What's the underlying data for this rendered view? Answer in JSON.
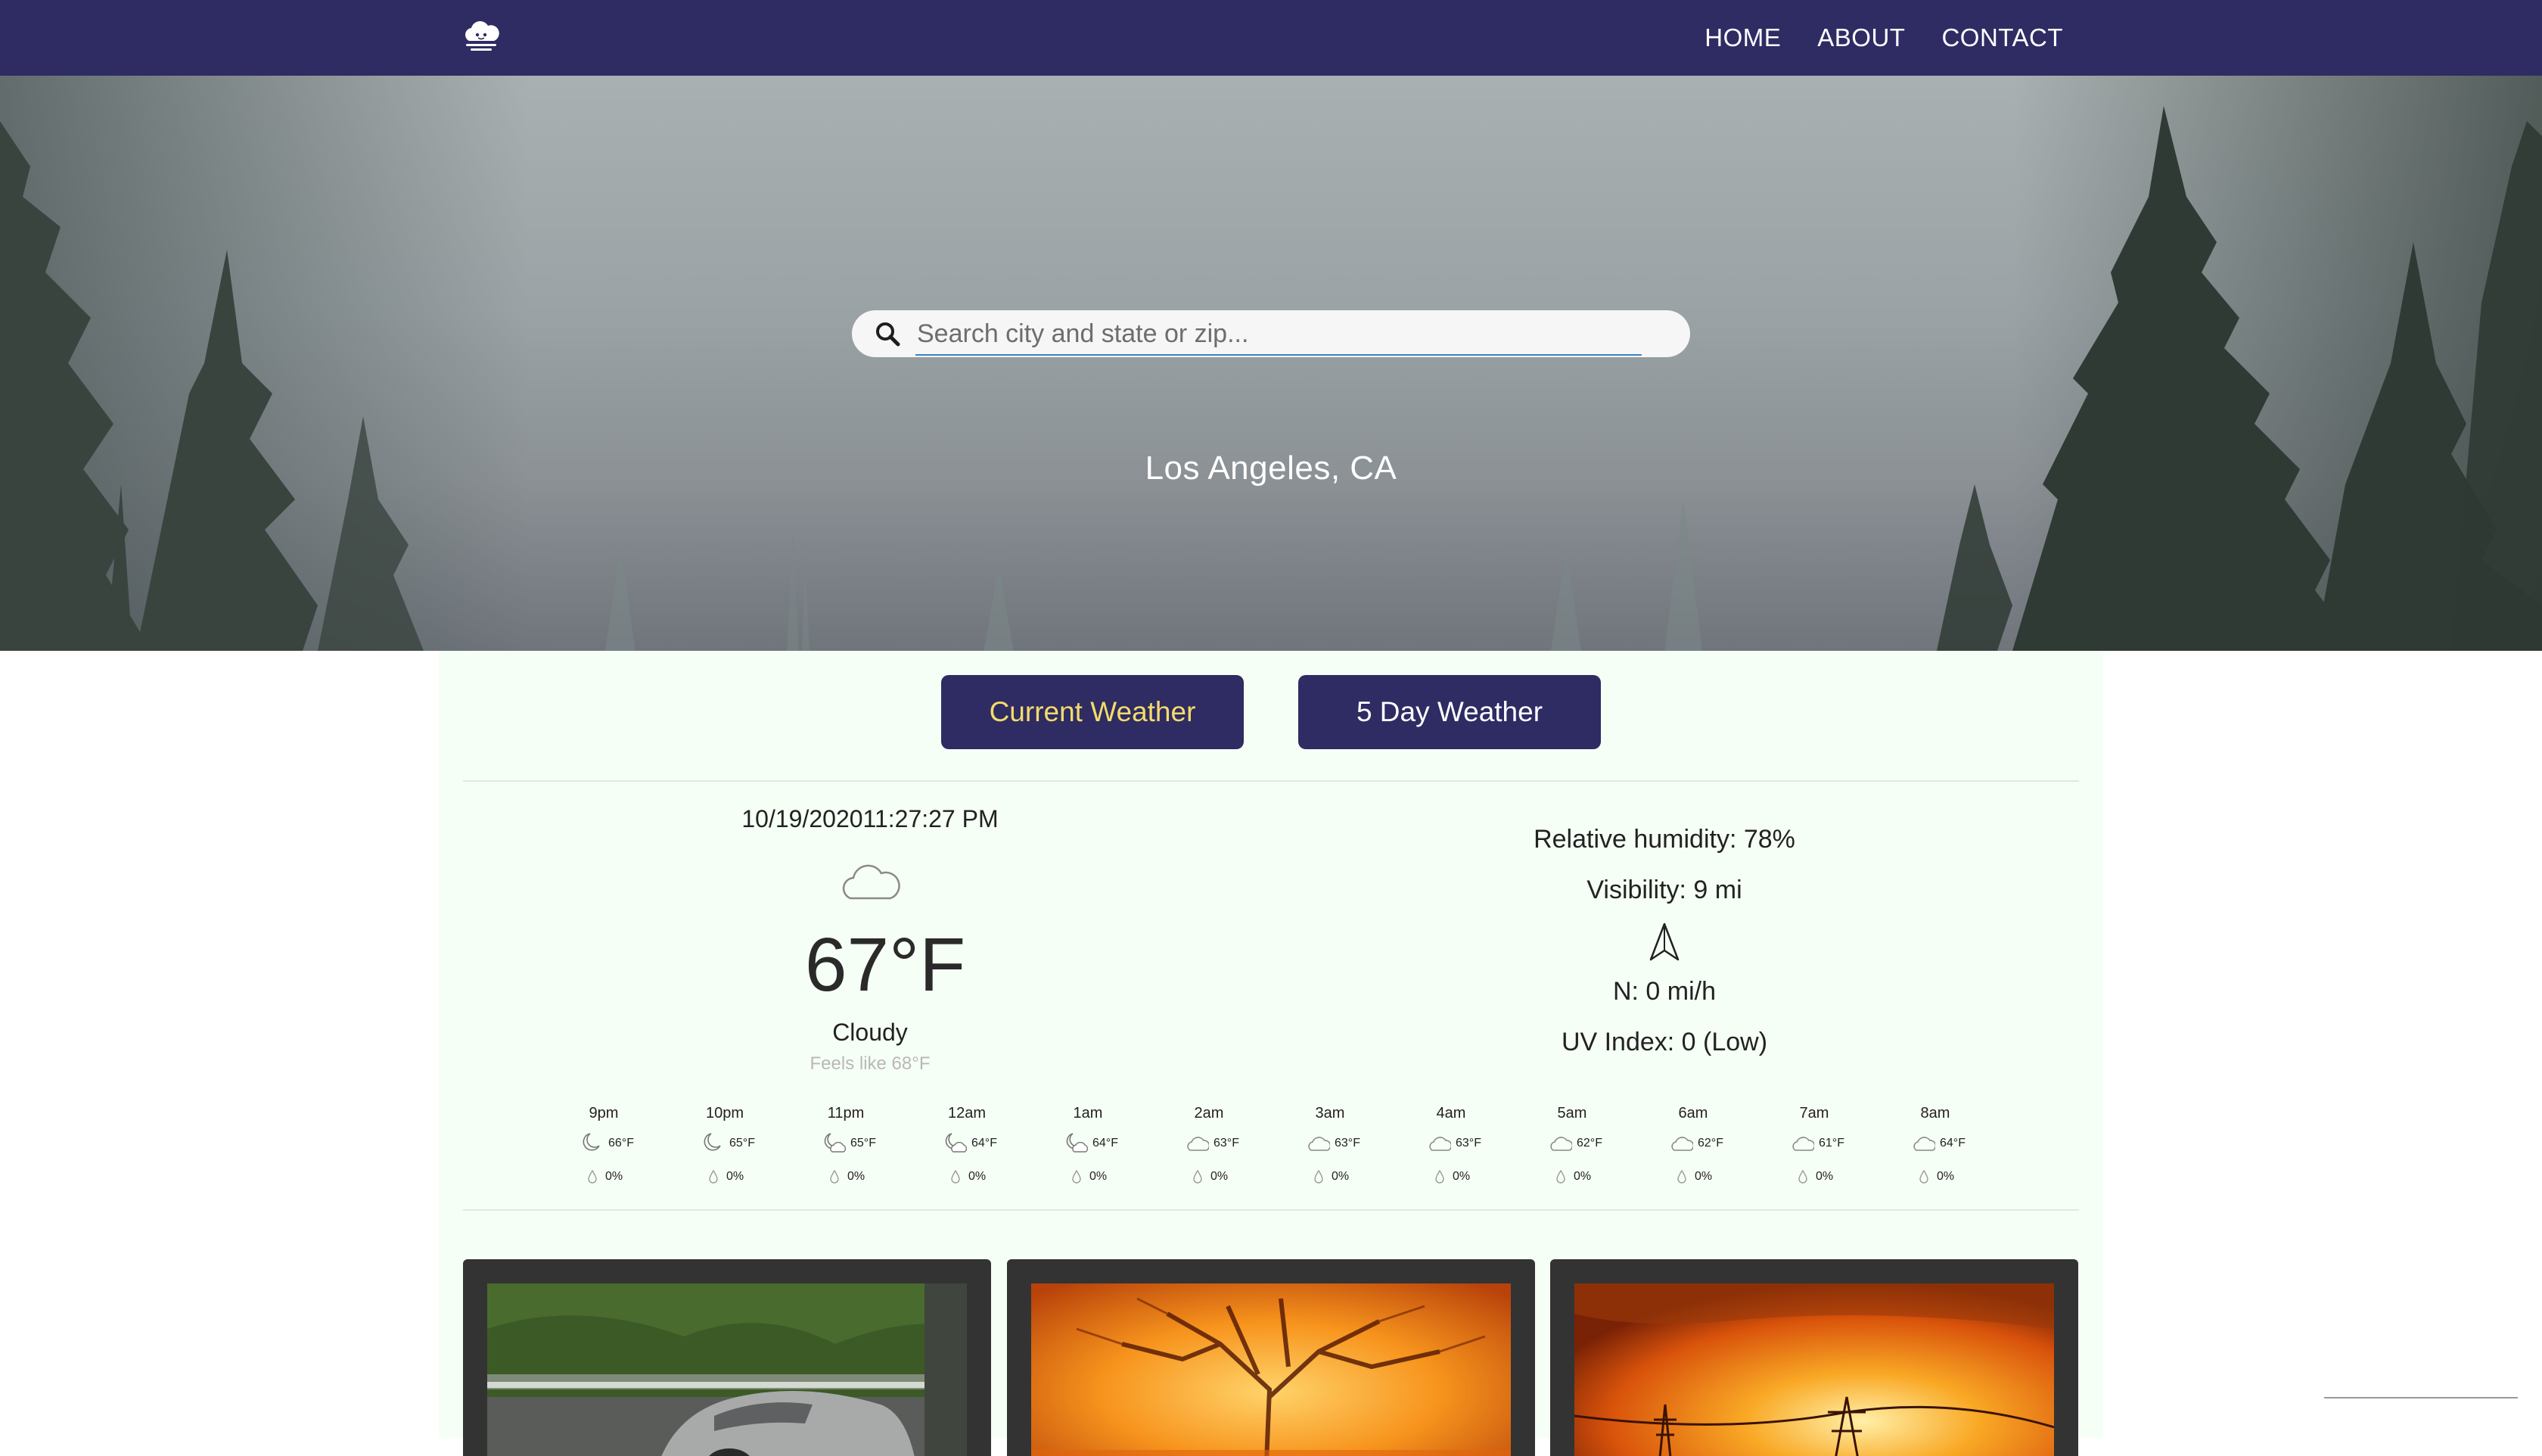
{
  "nav": {
    "logo_icon": "cloud-logo-icon",
    "links": [
      "HOME",
      "ABOUT",
      "CONTACT"
    ]
  },
  "search": {
    "placeholder": "Search city and state or zip...",
    "value": ""
  },
  "location": "Los Angeles, CA",
  "tabs": {
    "current": "Current Weather",
    "five_day": "5 Day Weather",
    "active": "current"
  },
  "current": {
    "datetime": "10/19/202011:27:27 PM",
    "icon": "cloud-icon",
    "temperature": "67°F",
    "condition": "Cloudy",
    "feels_like": "Feels like 68°F",
    "humidity": "Relative humidity: 78%",
    "visibility": "Visibility: 9 mi",
    "wind_icon": "navigation-arrow-icon",
    "wind": "N: 0 mi/h",
    "uv": "UV Index: 0 (Low)"
  },
  "hourly": [
    {
      "time": "9pm",
      "icon": "moon",
      "temp": "66°F",
      "precip": "0%"
    },
    {
      "time": "10pm",
      "icon": "moon",
      "temp": "65°F",
      "precip": "0%"
    },
    {
      "time": "11pm",
      "icon": "moon-cloud",
      "temp": "65°F",
      "precip": "0%"
    },
    {
      "time": "12am",
      "icon": "moon-cloud",
      "temp": "64°F",
      "precip": "0%"
    },
    {
      "time": "1am",
      "icon": "moon-cloud",
      "temp": "64°F",
      "precip": "0%"
    },
    {
      "time": "2am",
      "icon": "cloud",
      "temp": "63°F",
      "precip": "0%"
    },
    {
      "time": "3am",
      "icon": "cloud",
      "temp": "63°F",
      "precip": "0%"
    },
    {
      "time": "4am",
      "icon": "cloud",
      "temp": "63°F",
      "precip": "0%"
    },
    {
      "time": "5am",
      "icon": "cloud",
      "temp": "62°F",
      "precip": "0%"
    },
    {
      "time": "6am",
      "icon": "cloud",
      "temp": "62°F",
      "precip": "0%"
    },
    {
      "time": "7am",
      "icon": "cloud",
      "temp": "61°F",
      "precip": "0%"
    },
    {
      "time": "8am",
      "icon": "cloud",
      "temp": "64°F",
      "precip": "0%"
    }
  ],
  "news": [
    {
      "image": "sports-car-photo"
    },
    {
      "image": "wildfire-tree-photo"
    },
    {
      "image": "wildfire-powerlines-photo"
    }
  ],
  "colors": {
    "nav_bg": "#2f2b63",
    "active_tab_text": "#f3dc6b",
    "panel_bg": "#f6fff5",
    "card_bg": "#333333"
  }
}
